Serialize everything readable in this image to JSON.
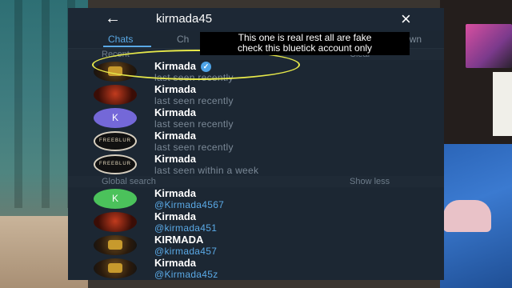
{
  "header": {
    "back_icon": "arrow-left-icon",
    "search_query": "kirmada45",
    "close_icon": "close-icon"
  },
  "tabs": [
    {
      "label": "Chats",
      "active": true
    },
    {
      "label": "Ch"
    },
    {
      "label": "own"
    }
  ],
  "sections": {
    "recent_label": "Recent",
    "recent_action": "Clear",
    "global_label": "Global search",
    "global_action": "Show less"
  },
  "recent": [
    {
      "name": "Kirmada",
      "status": "last seen recently",
      "verified": true
    },
    {
      "name": "Kirmada",
      "status": "last seen recently"
    },
    {
      "name": "Kirmada",
      "status": "last seen recently",
      "avatar_letter": "K"
    },
    {
      "name": "Kirmada",
      "status": "last seen recently",
      "avatar_text": "FREEBLUR"
    },
    {
      "name": "Kirmada",
      "status": "last seen within a week",
      "avatar_text": "FREEBLUR"
    }
  ],
  "global": [
    {
      "name": "Kirmada",
      "username": "@Kirmada4567",
      "avatar_letter": "K"
    },
    {
      "name": "Kirmada",
      "username": "@kirmada451"
    },
    {
      "name": "KIRMADA",
      "username": "@kirmada457"
    },
    {
      "name": "Kirmada",
      "username": "@Kirmada45z"
    }
  ],
  "annotation": {
    "line1": "This one is real rest all are fake",
    "line2": "check this  bluetick account only",
    "highlight_color": "#e6e84a"
  },
  "colors": {
    "accent": "#5aa9e6",
    "panel": "#1c2733",
    "verified": "#4ea4e8"
  }
}
